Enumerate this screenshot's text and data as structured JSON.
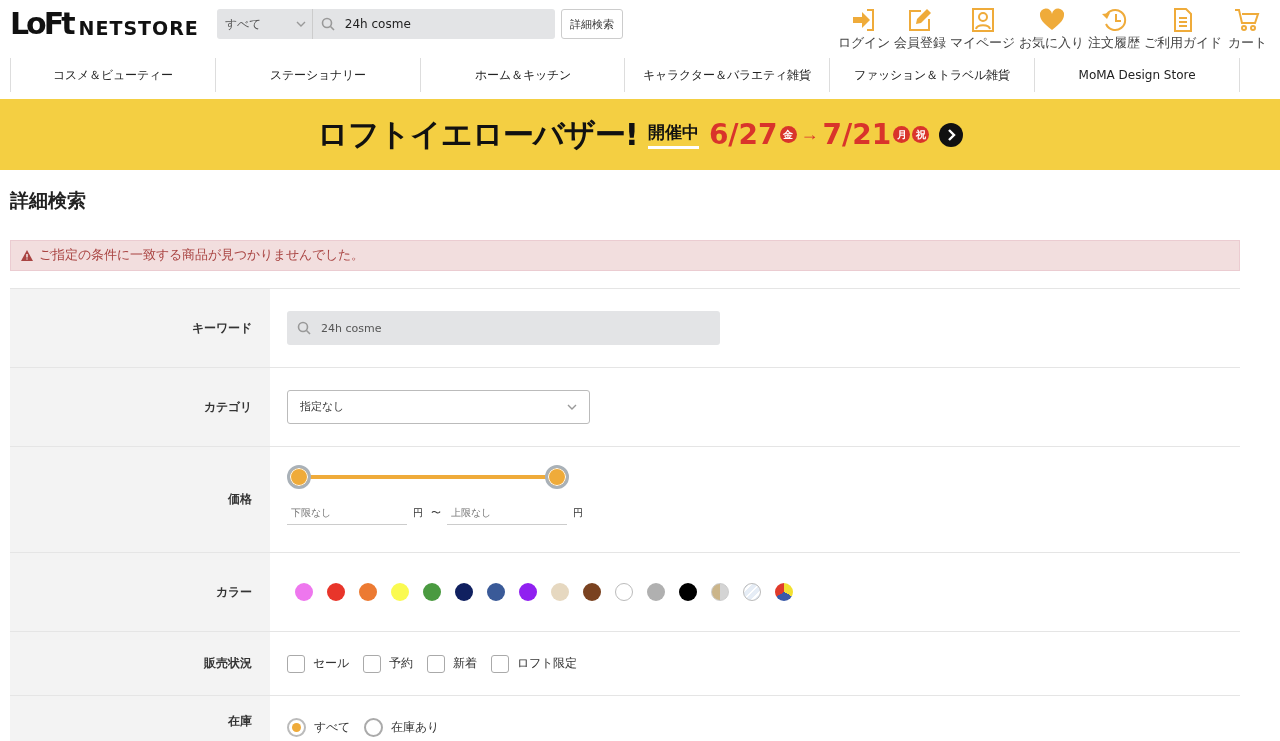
{
  "header": {
    "logo_mark": "LoFt",
    "logo_text": "NETSTORE",
    "scope_select": {
      "value": "すべて"
    },
    "search": {
      "value": "24h cosme"
    },
    "advanced_button": "詳細検索",
    "icons": [
      {
        "kind": "login",
        "label": "ログイン"
      },
      {
        "kind": "register",
        "label": "会員登録"
      },
      {
        "kind": "mypage",
        "label": "マイページ"
      },
      {
        "kind": "favorite",
        "label": "お気に入り"
      },
      {
        "kind": "history",
        "label": "注文履歴"
      },
      {
        "kind": "guide",
        "label": "ご利用ガイド"
      },
      {
        "kind": "cart",
        "label": "カート"
      }
    ]
  },
  "nav": [
    "コスメ＆ビューティー",
    "ステーショナリー",
    "ホーム＆キッチン",
    "キャラクター＆バラエティ雑貨",
    "ファッション＆トラベル雑貨",
    "MoMA Design Store"
  ],
  "banner": {
    "title": "ロフトイエローバザー!",
    "status": "開催中",
    "start": "6/27",
    "start_day": "金",
    "arrow": "→",
    "end": "7/21",
    "end_day": "月",
    "holiday": "祝"
  },
  "page_title": "詳細検索",
  "alert": "ご指定の条件に一致する商品が見つかりませんでした。",
  "form": {
    "keyword": {
      "label": "キーワード",
      "value": "24h cosme"
    },
    "category": {
      "label": "カテゴリ",
      "value": "指定なし"
    },
    "price": {
      "label": "価格",
      "thumbs": [
        {
          "level": 0
        },
        {
          "level": 1
        }
      ],
      "min_placeholder": "下限なし",
      "max_placeholder": "上限なし",
      "unit_min": "円",
      "tilde": "〜",
      "unit_max": "円"
    },
    "color": {
      "label": "カラー",
      "swatches": [
        {
          "kind": "solid",
          "color": "#ee77ee"
        },
        {
          "kind": "solid",
          "color": "#e8352a"
        },
        {
          "kind": "solid",
          "color": "#ec7a32"
        },
        {
          "kind": "solid",
          "color": "#fafa50"
        },
        {
          "kind": "solid",
          "color": "#4a9a40"
        },
        {
          "kind": "solid",
          "color": "#102060"
        },
        {
          "kind": "solid",
          "color": "#3a5a98"
        },
        {
          "kind": "solid",
          "color": "#9020f0"
        },
        {
          "kind": "solid",
          "color": "#e6d8c0"
        },
        {
          "kind": "solid",
          "color": "#7a4220"
        },
        {
          "kind": "solid",
          "color": "#ffffff"
        },
        {
          "kind": "solid",
          "color": "#b0b0b0"
        },
        {
          "kind": "solid",
          "color": "#000000"
        },
        {
          "kind": "gold-silver"
        },
        {
          "kind": "clear"
        },
        {
          "kind": "multi"
        }
      ]
    },
    "status": {
      "label": "販売状況",
      "options": [
        {
          "label": "セール",
          "checked": false
        },
        {
          "label": "予約",
          "checked": false
        },
        {
          "label": "新着",
          "checked": false
        },
        {
          "label": "ロフト限定",
          "checked": false
        }
      ]
    },
    "stock": {
      "label": "在庫",
      "options": [
        {
          "label": "すべて",
          "selected": true
        },
        {
          "label": "在庫あり",
          "selected": false
        }
      ]
    }
  }
}
